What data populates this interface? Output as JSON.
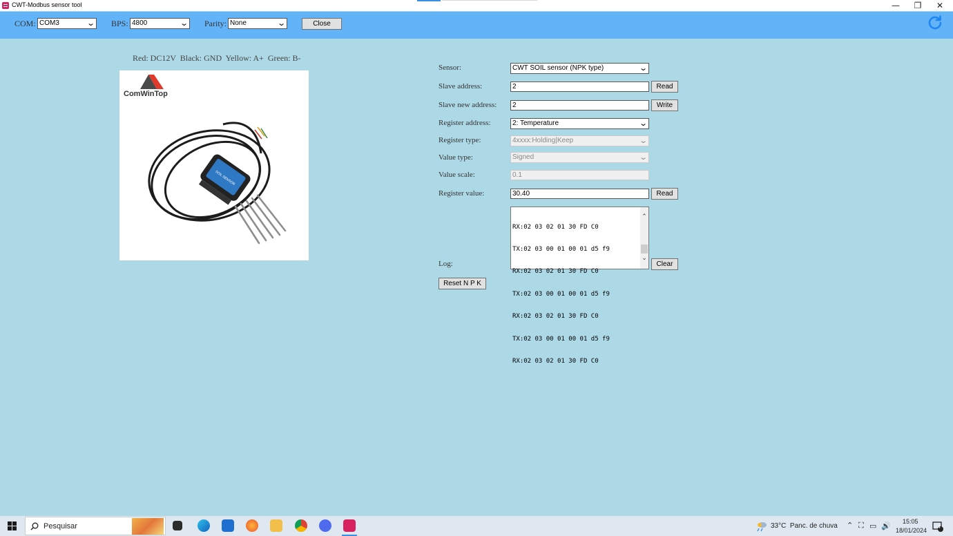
{
  "window": {
    "title": "CWT-Modbus sensor tool",
    "minimize": "—",
    "restore": "❐",
    "close": "✕"
  },
  "toolbar": {
    "com_label": "COM:",
    "com_value": "COM3",
    "bps_label": "BPS:",
    "bps_value": "4800",
    "parity_label": "Parity:",
    "parity_value": "None",
    "close_button": "Close",
    "refresh_icon": "refresh-icon",
    "accent": "#63b3f9"
  },
  "wiring": "Red: DC12V  Black: GND  Yellow: A+  Green: B-",
  "photo": {
    "brand": "ComWinTop",
    "label": "SOIL SENSOR"
  },
  "form": {
    "sensor_label": "Sensor:",
    "sensor_value": "CWT SOIL sensor (NPK type)",
    "slave_label": "Slave address:",
    "slave_value": "2",
    "slave_read": "Read",
    "new_label": "Slave new address:",
    "new_value": "2",
    "new_write": "Write",
    "reg_addr_label": "Register address:",
    "reg_addr_value": "2: Temperature",
    "reg_type_label": "Register type:",
    "reg_type_value": "4xxxx:Holding|Keep",
    "value_type_label": "Value type:",
    "value_type_value": "Signed",
    "scale_label": "Value scale:",
    "scale_value": "0.1",
    "reg_value_label": "Register value:",
    "reg_value": "30.40",
    "reg_read": "Read",
    "log_label": "Log:",
    "log_lines": [
      "RX:02 03 02 01 30 FD C0",
      "TX:02 03 00 01 00 01 d5 f9",
      "RX:02 03 02 01 30 FD C0",
      "TX:02 03 00 01 00 01 d5 f9",
      "RX:02 03 02 01 30 FD C0",
      "TX:02 03 00 01 00 01 d5 f9",
      "RX:02 03 02 01 30 FD C0"
    ],
    "clear_button": "Clear",
    "reset_button": "Reset N P K"
  },
  "taskbar": {
    "search_placeholder": "Pesquisar",
    "weather": "33°C  Panc. de chuva",
    "time": "15:05",
    "date": "18/01/2024",
    "notification_count": "4"
  }
}
